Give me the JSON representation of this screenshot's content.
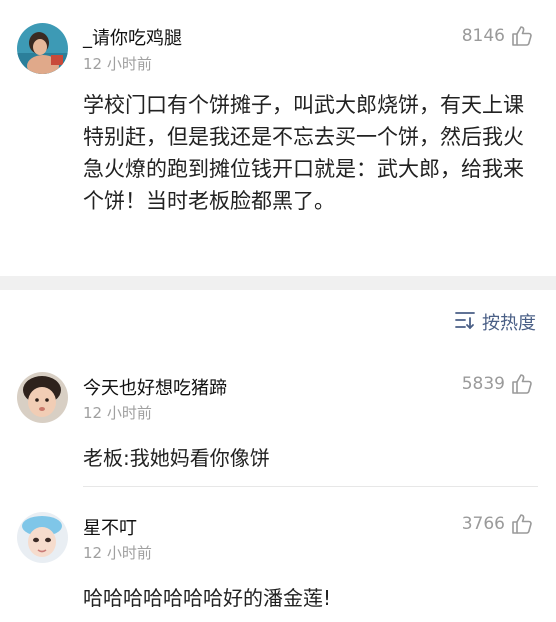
{
  "main_post": {
    "author": "_请你吃鸡腿",
    "time": "12 小时前",
    "likes": "8146",
    "text": "学校门口有个饼摊子，叫武大郎烧饼，有天上课特别赶，但是我还是不忘去买一个饼，然后我火急火燎的跑到摊位钱开口就是：武大郎，给我来个饼！当时老板脸都黑了。"
  },
  "sort": {
    "label": "按热度",
    "icon": "sort-icon"
  },
  "comments": [
    {
      "author": "今天也好想吃猪蹄",
      "time": "12 小时前",
      "likes": "5839",
      "text": "老板:我她妈看你像饼"
    },
    {
      "author": "星不叮",
      "time": "12 小时前",
      "likes": "3766",
      "text": "哈哈哈哈哈哈哈好的潘金莲!"
    }
  ],
  "colors": {
    "link": "#4a5f86",
    "muted": "#a0a0a0",
    "separator": "#f0f0f0"
  }
}
